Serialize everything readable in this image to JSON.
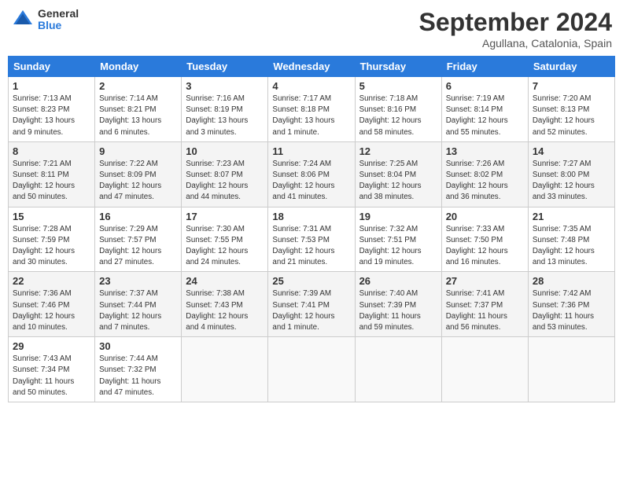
{
  "header": {
    "logo_line1": "General",
    "logo_line2": "Blue",
    "month_title": "September 2024",
    "subtitle": "Agullana, Catalonia, Spain"
  },
  "weekdays": [
    "Sunday",
    "Monday",
    "Tuesday",
    "Wednesday",
    "Thursday",
    "Friday",
    "Saturday"
  ],
  "weeks": [
    [
      {
        "day": "1",
        "info": "Sunrise: 7:13 AM\nSunset: 8:23 PM\nDaylight: 13 hours\nand 9 minutes."
      },
      {
        "day": "2",
        "info": "Sunrise: 7:14 AM\nSunset: 8:21 PM\nDaylight: 13 hours\nand 6 minutes."
      },
      {
        "day": "3",
        "info": "Sunrise: 7:16 AM\nSunset: 8:19 PM\nDaylight: 13 hours\nand 3 minutes."
      },
      {
        "day": "4",
        "info": "Sunrise: 7:17 AM\nSunset: 8:18 PM\nDaylight: 13 hours\nand 1 minute."
      },
      {
        "day": "5",
        "info": "Sunrise: 7:18 AM\nSunset: 8:16 PM\nDaylight: 12 hours\nand 58 minutes."
      },
      {
        "day": "6",
        "info": "Sunrise: 7:19 AM\nSunset: 8:14 PM\nDaylight: 12 hours\nand 55 minutes."
      },
      {
        "day": "7",
        "info": "Sunrise: 7:20 AM\nSunset: 8:13 PM\nDaylight: 12 hours\nand 52 minutes."
      }
    ],
    [
      {
        "day": "8",
        "info": "Sunrise: 7:21 AM\nSunset: 8:11 PM\nDaylight: 12 hours\nand 50 minutes."
      },
      {
        "day": "9",
        "info": "Sunrise: 7:22 AM\nSunset: 8:09 PM\nDaylight: 12 hours\nand 47 minutes."
      },
      {
        "day": "10",
        "info": "Sunrise: 7:23 AM\nSunset: 8:07 PM\nDaylight: 12 hours\nand 44 minutes."
      },
      {
        "day": "11",
        "info": "Sunrise: 7:24 AM\nSunset: 8:06 PM\nDaylight: 12 hours\nand 41 minutes."
      },
      {
        "day": "12",
        "info": "Sunrise: 7:25 AM\nSunset: 8:04 PM\nDaylight: 12 hours\nand 38 minutes."
      },
      {
        "day": "13",
        "info": "Sunrise: 7:26 AM\nSunset: 8:02 PM\nDaylight: 12 hours\nand 36 minutes."
      },
      {
        "day": "14",
        "info": "Sunrise: 7:27 AM\nSunset: 8:00 PM\nDaylight: 12 hours\nand 33 minutes."
      }
    ],
    [
      {
        "day": "15",
        "info": "Sunrise: 7:28 AM\nSunset: 7:59 PM\nDaylight: 12 hours\nand 30 minutes."
      },
      {
        "day": "16",
        "info": "Sunrise: 7:29 AM\nSunset: 7:57 PM\nDaylight: 12 hours\nand 27 minutes."
      },
      {
        "day": "17",
        "info": "Sunrise: 7:30 AM\nSunset: 7:55 PM\nDaylight: 12 hours\nand 24 minutes."
      },
      {
        "day": "18",
        "info": "Sunrise: 7:31 AM\nSunset: 7:53 PM\nDaylight: 12 hours\nand 21 minutes."
      },
      {
        "day": "19",
        "info": "Sunrise: 7:32 AM\nSunset: 7:51 PM\nDaylight: 12 hours\nand 19 minutes."
      },
      {
        "day": "20",
        "info": "Sunrise: 7:33 AM\nSunset: 7:50 PM\nDaylight: 12 hours\nand 16 minutes."
      },
      {
        "day": "21",
        "info": "Sunrise: 7:35 AM\nSunset: 7:48 PM\nDaylight: 12 hours\nand 13 minutes."
      }
    ],
    [
      {
        "day": "22",
        "info": "Sunrise: 7:36 AM\nSunset: 7:46 PM\nDaylight: 12 hours\nand 10 minutes."
      },
      {
        "day": "23",
        "info": "Sunrise: 7:37 AM\nSunset: 7:44 PM\nDaylight: 12 hours\nand 7 minutes."
      },
      {
        "day": "24",
        "info": "Sunrise: 7:38 AM\nSunset: 7:43 PM\nDaylight: 12 hours\nand 4 minutes."
      },
      {
        "day": "25",
        "info": "Sunrise: 7:39 AM\nSunset: 7:41 PM\nDaylight: 12 hours\nand 1 minute."
      },
      {
        "day": "26",
        "info": "Sunrise: 7:40 AM\nSunset: 7:39 PM\nDaylight: 11 hours\nand 59 minutes."
      },
      {
        "day": "27",
        "info": "Sunrise: 7:41 AM\nSunset: 7:37 PM\nDaylight: 11 hours\nand 56 minutes."
      },
      {
        "day": "28",
        "info": "Sunrise: 7:42 AM\nSunset: 7:36 PM\nDaylight: 11 hours\nand 53 minutes."
      }
    ],
    [
      {
        "day": "29",
        "info": "Sunrise: 7:43 AM\nSunset: 7:34 PM\nDaylight: 11 hours\nand 50 minutes."
      },
      {
        "day": "30",
        "info": "Sunrise: 7:44 AM\nSunset: 7:32 PM\nDaylight: 11 hours\nand 47 minutes."
      },
      {
        "day": "",
        "info": ""
      },
      {
        "day": "",
        "info": ""
      },
      {
        "day": "",
        "info": ""
      },
      {
        "day": "",
        "info": ""
      },
      {
        "day": "",
        "info": ""
      }
    ]
  ]
}
